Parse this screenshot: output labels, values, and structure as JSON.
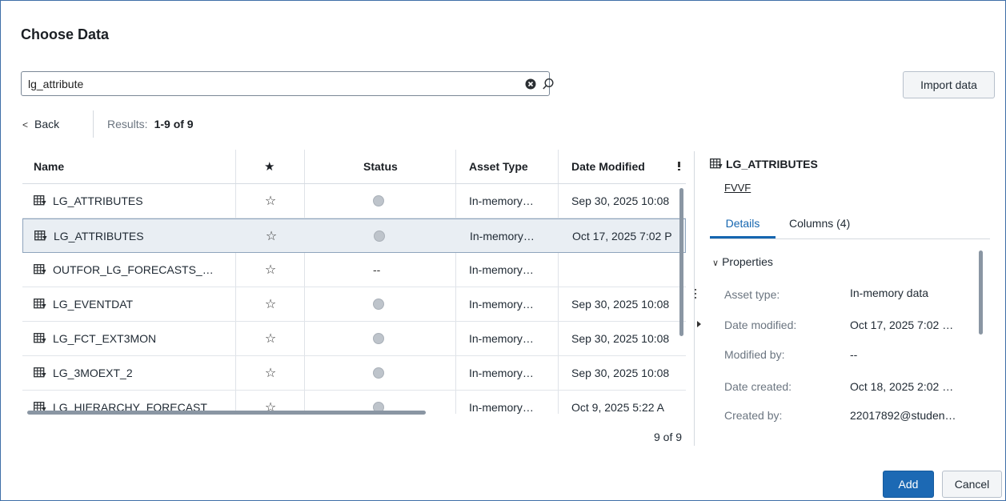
{
  "dialog": {
    "title": "Choose Data"
  },
  "search": {
    "value": "lg_attribute",
    "clear_icon": "clear-circle-icon",
    "search_icon": "search-icon"
  },
  "toolbar": {
    "import_label": "Import data"
  },
  "nav": {
    "back_label": "Back",
    "results_label": "Results:",
    "results_range": "1-9 of 9"
  },
  "table": {
    "columns": [
      "Name",
      "★",
      "Status",
      "Asset Type",
      "Date Modified"
    ],
    "rows": [
      {
        "name": "LG_ATTRIBUTES",
        "favorite": "☆",
        "status": "dot",
        "asset_type": "In-memory…",
        "date_modified": "Sep 30, 2025 10:08",
        "selected": false
      },
      {
        "name": "LG_ATTRIBUTES",
        "favorite": "☆",
        "status": "dot",
        "asset_type": "In-memory…",
        "date_modified": "Oct 17, 2025 7:02 P",
        "selected": true
      },
      {
        "name": "OUTFOR_LG_FORECASTS_…",
        "favorite": "☆",
        "status": "--",
        "asset_type": "In-memory…",
        "date_modified": "",
        "selected": false
      },
      {
        "name": "LG_EVENTDAT",
        "favorite": "☆",
        "status": "dot",
        "asset_type": "In-memory…",
        "date_modified": "Sep 30, 2025 10:08",
        "selected": false
      },
      {
        "name": "LG_FCT_EXT3MON",
        "favorite": "☆",
        "status": "dot",
        "asset_type": "In-memory…",
        "date_modified": "Sep 30, 2025 10:08",
        "selected": false
      },
      {
        "name": "LG_3MOEXT_2",
        "favorite": "☆",
        "status": "dot",
        "asset_type": "In-memory…",
        "date_modified": "Sep 30, 2025 10:08",
        "selected": false
      },
      {
        "name": "LG_HIERARCHY_FORECAST",
        "favorite": "☆",
        "status": "dot",
        "asset_type": "In-memory…",
        "date_modified": "Oct 9, 2025 5:22 A",
        "selected": false
      }
    ],
    "count_label": "9 of 9"
  },
  "details": {
    "title": "LG_ATTRIBUTES",
    "link": "FVVF",
    "tabs": [
      "Details",
      "Columns (4)"
    ],
    "section_label": "Properties",
    "properties": [
      {
        "label": "Asset type:",
        "value": "In-memory data"
      },
      {
        "label": "Date modified:",
        "value": "Oct 17, 2025 7:02 …"
      },
      {
        "label": "Modified by:",
        "value": "--"
      },
      {
        "label": "Date created:",
        "value": "Oct 18, 2025 2:02 …"
      },
      {
        "label": "Created by:",
        "value": "22017892@studen…"
      }
    ]
  },
  "footer": {
    "add_label": "Add",
    "cancel_label": "Cancel"
  },
  "colors": {
    "accent": "#1c69b4",
    "selected_row": "#e9eef3",
    "status_dot": "#bec4cb"
  }
}
